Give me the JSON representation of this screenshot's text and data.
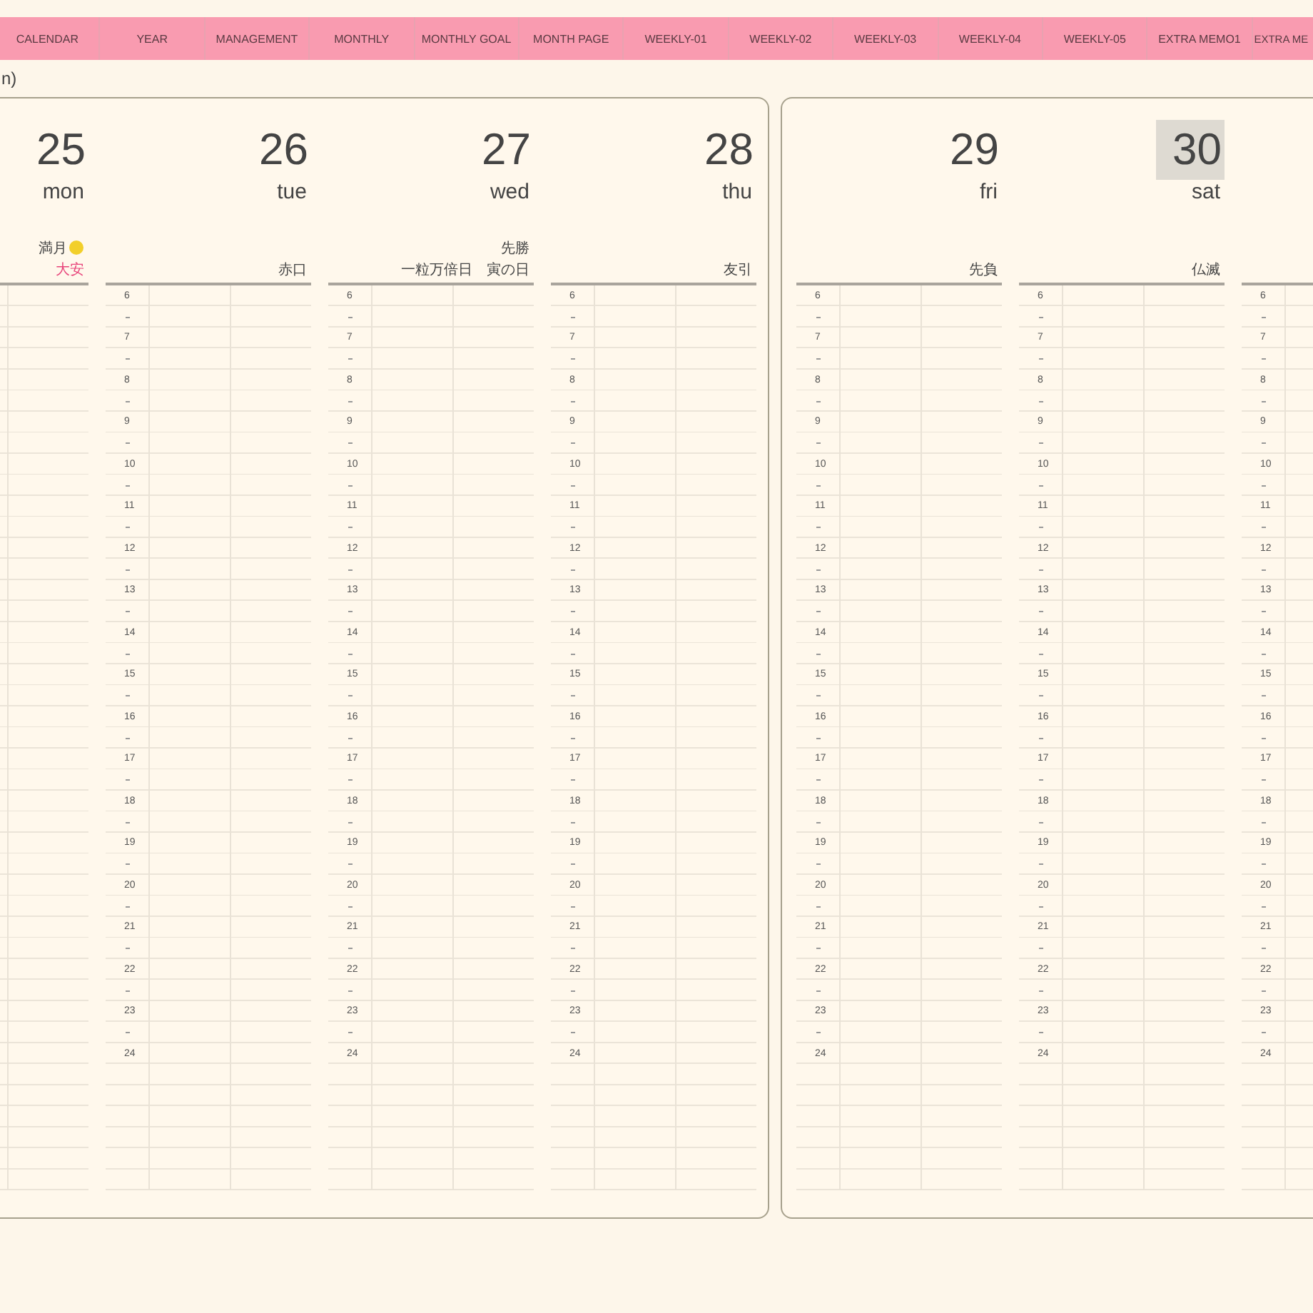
{
  "tabs": [
    {
      "label": "CALENDAR"
    },
    {
      "label": "YEAR"
    },
    {
      "label": "MANAGEMENT"
    },
    {
      "label": "MONTHLY"
    },
    {
      "label": "MONTHLY GOAL"
    },
    {
      "label": "MONTH PAGE"
    },
    {
      "label": "WEEKLY-01"
    },
    {
      "label": "WEEKLY-02"
    },
    {
      "label": "WEEKLY-03"
    },
    {
      "label": "WEEKLY-04"
    },
    {
      "label": "WEEKLY-05"
    },
    {
      "label": "EXTRA MEMO1"
    },
    {
      "label": "EXTRA ME"
    }
  ],
  "header_fragment": "n)",
  "pages": [
    {
      "days": [
        {
          "date": "25",
          "weekday": "mon",
          "selected": false,
          "notes": [
            {
              "kind": "moon",
              "text": "満月",
              "color": "#444444"
            },
            {
              "kind": "text",
              "text": "大安",
              "color": "#e8447a"
            }
          ]
        },
        {
          "date": "26",
          "weekday": "tue",
          "selected": false,
          "notes": [
            {
              "kind": "text",
              "text": "赤口",
              "color": "#444444"
            }
          ],
          "hours": [
            "6",
            "7",
            "8",
            "9",
            "10",
            "11",
            "12",
            "13",
            "14",
            "15",
            "16",
            "17",
            "18",
            "19",
            "20",
            "21",
            "22",
            "23",
            "24"
          ]
        },
        {
          "date": "27",
          "weekday": "wed",
          "selected": false,
          "notes": [
            {
              "kind": "text",
              "text": "先勝",
              "color": "#444444"
            },
            {
              "kind": "text",
              "text": "一粒万倍日　寅の日",
              "color": "#444444"
            }
          ],
          "hours": [
            "6",
            "7",
            "8",
            "9",
            "10",
            "11",
            "12",
            "13",
            "14",
            "15",
            "16",
            "17",
            "18",
            "19",
            "20",
            "21",
            "22",
            "23",
            "24"
          ]
        },
        {
          "date": "28",
          "weekday": "thu",
          "selected": false,
          "notes": [
            {
              "kind": "text",
              "text": "友引",
              "color": "#444444"
            }
          ],
          "hours": [
            "6",
            "7",
            "8",
            "9",
            "10",
            "11",
            "12",
            "13",
            "14",
            "15",
            "16",
            "17",
            "18",
            "19",
            "20",
            "21",
            "22",
            "23",
            "24"
          ]
        }
      ]
    },
    {
      "days": [
        {
          "date": "29",
          "weekday": "fri",
          "selected": false,
          "notes": [
            {
              "kind": "text",
              "text": "先負",
              "color": "#444444"
            }
          ],
          "hours": [
            "6",
            "7",
            "8",
            "9",
            "10",
            "11",
            "12",
            "13",
            "14",
            "15",
            "16",
            "17",
            "18",
            "19",
            "20",
            "21",
            "22",
            "23",
            "24"
          ]
        },
        {
          "date": "30",
          "weekday": "sat",
          "selected": true,
          "notes": [
            {
              "kind": "text",
              "text": "仏滅",
              "color": "#444444"
            }
          ],
          "hours": [
            "6",
            "7",
            "8",
            "9",
            "10",
            "11",
            "12",
            "13",
            "14",
            "15",
            "16",
            "17",
            "18",
            "19",
            "20",
            "21",
            "22",
            "23",
            "24"
          ]
        },
        {
          "hours": [
            "6",
            "7",
            "8",
            "9",
            "10",
            "11",
            "12",
            "13",
            "14",
            "15",
            "16",
            "17",
            "18",
            "19",
            "20",
            "21",
            "22",
            "23",
            "24"
          ]
        }
      ]
    }
  ]
}
